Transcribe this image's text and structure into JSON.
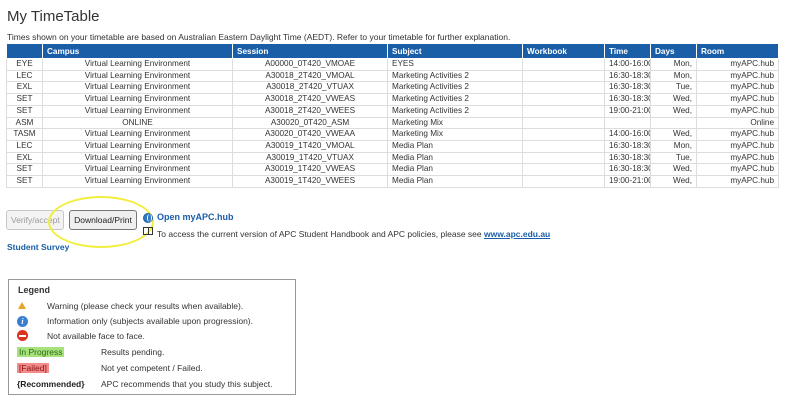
{
  "page": {
    "title": "My TimeTable",
    "note": "Times shown on your timetable are based on Australian Eastern Daylight Time (AEDT). Refer to your timetable for further explanation."
  },
  "table": {
    "headers": [
      "Campus",
      "Session",
      "Subject",
      "Workbook",
      "Time",
      "Days",
      "Room"
    ],
    "rows": [
      [
        "EYE",
        "Virtual Learning Environment",
        "A00000_0T420_VMOAE",
        "EYES",
        "",
        "14:00-16:00",
        "Mon,",
        "myAPC.hub"
      ],
      [
        "LEC",
        "Virtual Learning Environment",
        "A30018_2T420_VMOAL",
        "Marketing Activities 2",
        "",
        "16:30-18:30",
        "Mon,",
        "myAPC.hub"
      ],
      [
        "EXL",
        "Virtual Learning Environment",
        "A30018_2T420_VTUAX",
        "Marketing Activities 2",
        "",
        "16:30-18:30",
        "Tue,",
        "myAPC.hub"
      ],
      [
        "SET",
        "Virtual Learning Environment",
        "A30018_2T420_VWEAS",
        "Marketing Activities 2",
        "",
        "16:30-18:30",
        "Wed,",
        "myAPC.hub"
      ],
      [
        "SET",
        "Virtual Learning Environment",
        "A30018_2T420_VWEES",
        "Marketing Activities 2",
        "",
        "19:00-21:00",
        "Wed,",
        "myAPC.hub"
      ],
      [
        "ASM",
        "ONLINE",
        "A30020_0T420_ASM",
        "Marketing Mix",
        "",
        "",
        "",
        "Online"
      ],
      [
        "TASM",
        "Virtual Learning Environment",
        "A30020_0T420_VWEAA",
        "Marketing Mix",
        "",
        "14:00-16:00",
        "Wed,",
        "myAPC.hub"
      ],
      [
        "LEC",
        "Virtual Learning Environment",
        "A30019_1T420_VMOAL",
        "Media Plan",
        "",
        "16:30-18:30",
        "Mon,",
        "myAPC.hub"
      ],
      [
        "EXL",
        "Virtual Learning Environment",
        "A30019_1T420_VTUAX",
        "Media Plan",
        "",
        "16:30-18:30",
        "Tue,",
        "myAPC.hub"
      ],
      [
        "SET",
        "Virtual Learning Environment",
        "A30019_1T420_VWEAS",
        "Media Plan",
        "",
        "16:30-18:30",
        "Wed,",
        "myAPC.hub"
      ],
      [
        "SET",
        "Virtual Learning Environment",
        "A30019_1T420_VWEES",
        "Media Plan",
        "",
        "19:00-21:00",
        "Wed,",
        "myAPC.hub"
      ]
    ]
  },
  "actions": {
    "verify_label": "Verify/accept",
    "download_label": "Download/Print",
    "open_hub_label": "Open myAPC.hub",
    "access_text": "To access the current version of APC Student Handbook and APC policies, please see ",
    "access_link": "www.apc.edu.au",
    "survey_label": "Student Survey"
  },
  "legend": {
    "title": "Legend",
    "warning": "Warning (please check your results when available).",
    "info": "Information only (subjects available upon progression).",
    "not_available": "Not available face to face.",
    "in_progress_badge": "In Progress",
    "in_progress_desc": "Results pending.",
    "failed_badge": "[Failed]",
    "failed_desc": "Not yet competent / Failed.",
    "recommended_badge": "{Recommended}",
    "recommended_desc": "APC recommends that you study this subject."
  },
  "colors": {
    "header_bg": "#1a5ea8",
    "link": "#1a5ea8",
    "highlight": "#f2ee40"
  }
}
